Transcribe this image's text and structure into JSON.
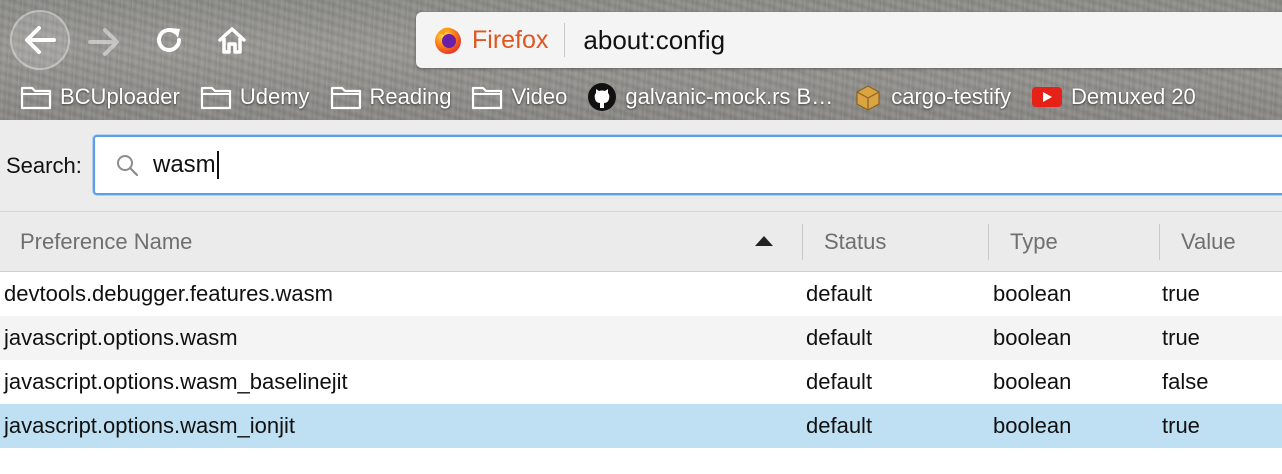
{
  "browser": {
    "identity_label": "Firefox",
    "url": "about:config",
    "accent_color": "#e0561f"
  },
  "bookmarks": [
    {
      "label": "BCUploader",
      "icon": "folder-icon"
    },
    {
      "label": "Udemy",
      "icon": "folder-icon"
    },
    {
      "label": "Reading",
      "icon": "folder-icon"
    },
    {
      "label": "Video",
      "icon": "folder-icon"
    },
    {
      "label": "galvanic-mock.rs B…",
      "icon": "github-icon"
    },
    {
      "label": "cargo-testify",
      "icon": "cargo-icon"
    },
    {
      "label": "Demuxed 20",
      "icon": "youtube-icon"
    }
  ],
  "search": {
    "label": "Search:",
    "value": "wasm"
  },
  "table": {
    "columns": [
      "Preference Name",
      "Status",
      "Type",
      "Value"
    ],
    "sorted_column": "Preference Name",
    "sort_direction": "ascending",
    "rows": [
      {
        "name": "devtools.debugger.features.wasm",
        "status": "default",
        "type": "boolean",
        "value": "true"
      },
      {
        "name": "javascript.options.wasm",
        "status": "default",
        "type": "boolean",
        "value": "true"
      },
      {
        "name": "javascript.options.wasm_baselinejit",
        "status": "default",
        "type": "boolean",
        "value": "false"
      },
      {
        "name": "javascript.options.wasm_ionjit",
        "status": "default",
        "type": "boolean",
        "value": "true"
      }
    ],
    "selected_row": 3,
    "selection_color": "#bfe0f3"
  }
}
